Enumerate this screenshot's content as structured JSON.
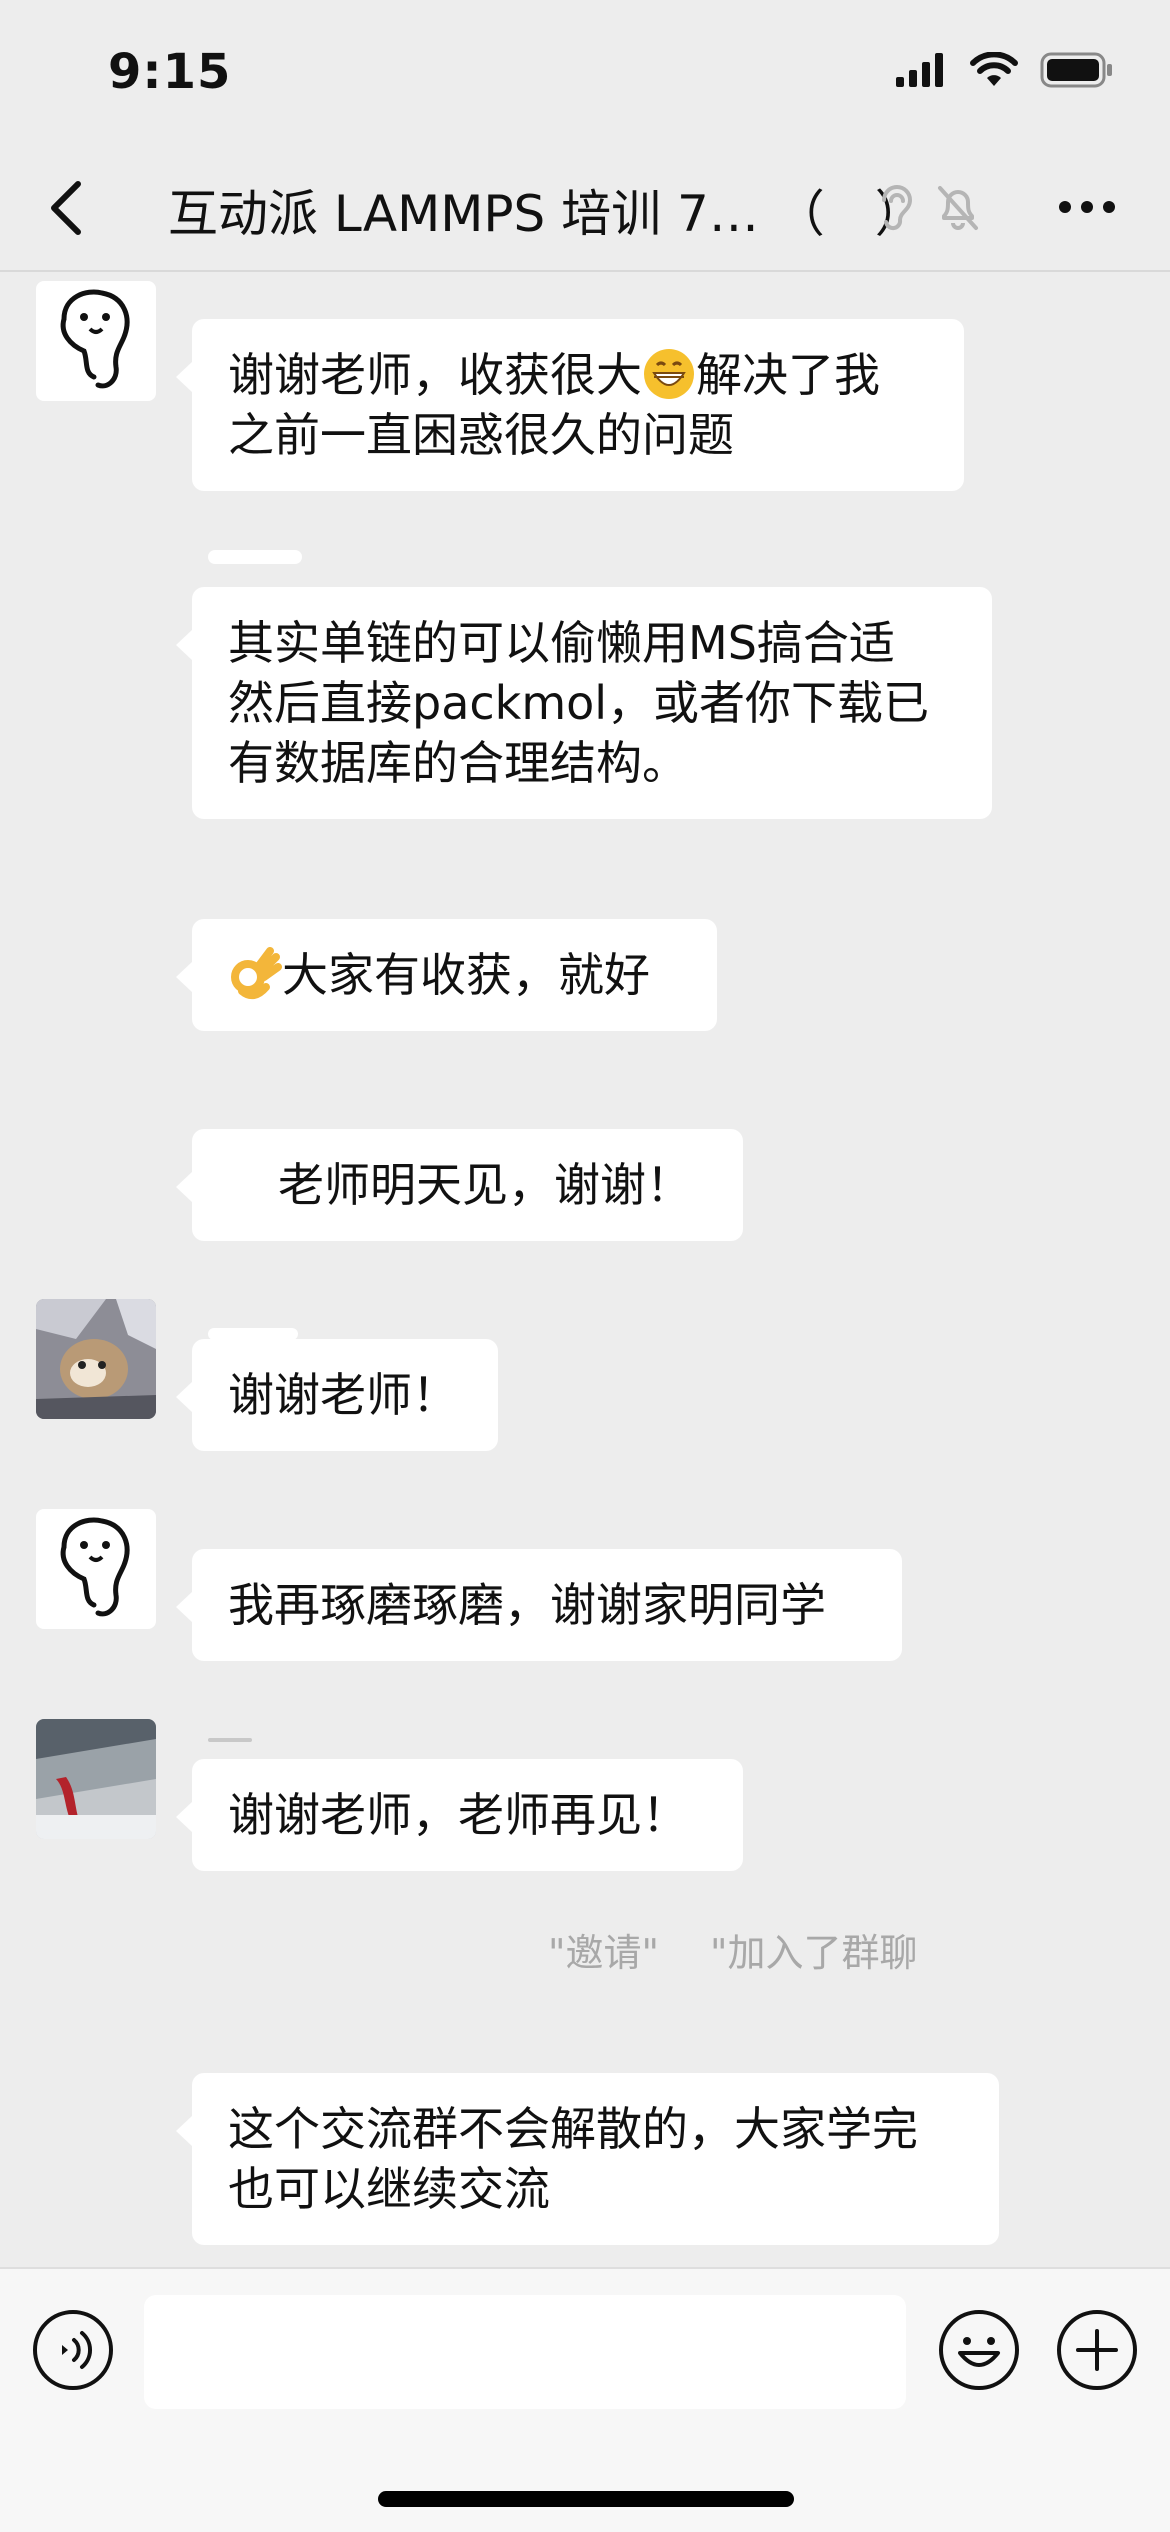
{
  "status": {
    "time": "9:15"
  },
  "nav": {
    "title": "互动派 LAMMPS 培训 7… （　）"
  },
  "messages": [
    {
      "sender": "ghost",
      "parts": [
        "谢谢老师，收获很大",
        "解决了我",
        "之前一直困惑很久的问题"
      ],
      "emoji": "grinning-face"
    },
    {
      "sender": "hidden",
      "text_lines": [
        "其实单链的可以偷懒用MS搞合适",
        "然后直接packmol，或者你下载已",
        "有数据库的合理结构。"
      ]
    },
    {
      "sender": "hidden",
      "emoji": "ok-hand",
      "text": "大家有收获，就好"
    },
    {
      "sender": "hidden",
      "text": "老师明天见，谢谢！"
    },
    {
      "sender": "cat",
      "text": "谢谢老师！"
    },
    {
      "sender": "ghost",
      "text": "我再琢磨琢磨，谢谢家明同学"
    },
    {
      "sender": "snow",
      "text": "谢谢老师，老师再见！"
    },
    {
      "sender": "hidden",
      "text_lines": [
        "这个交流群不会解散的，大家学完",
        "也可以继续交流"
      ]
    }
  ],
  "system_notice": {
    "part1": "\"邀请\"",
    "part2": "\"加入了群聊"
  },
  "input": {
    "placeholder": ""
  },
  "colors": {
    "background": "#ededed",
    "bubble": "#ffffff",
    "system_text": "#a8a8a8"
  },
  "icons": [
    "back-icon",
    "ear-icon",
    "mute-bell-icon",
    "more-icon",
    "voice-icon",
    "emoji-icon",
    "plus-icon"
  ]
}
